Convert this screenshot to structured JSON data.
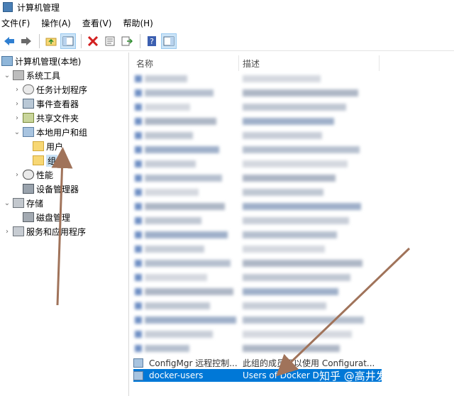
{
  "window": {
    "title": "计算机管理"
  },
  "menu": {
    "items": [
      "文件(F)",
      "操作(A)",
      "查看(V)",
      "帮助(H)"
    ]
  },
  "toolbar": {
    "back_icon": "arrow-left-icon",
    "forward_icon": "arrow-right-icon",
    "delete_icon": "red-x-icon",
    "help_icon": "help-icon"
  },
  "tree": {
    "root": "计算机管理(本地)",
    "items": [
      {
        "label": "系统工具",
        "icon": "tools-icon"
      },
      {
        "label": "任务计划程序",
        "icon": "clock-icon"
      },
      {
        "label": "事件查看器",
        "icon": "event-viewer-icon"
      },
      {
        "label": "共享文件夹",
        "icon": "shared-folder-icon"
      },
      {
        "label": "本地用户和组",
        "icon": "local-users-icon"
      },
      {
        "label": "用户",
        "icon": "folder-icon"
      },
      {
        "label": "组",
        "icon": "folder-icon"
      },
      {
        "label": "性能",
        "icon": "performance-icon"
      },
      {
        "label": "设备管理器",
        "icon": "device-manager-icon"
      },
      {
        "label": "存储",
        "icon": "storage-icon"
      },
      {
        "label": "磁盘管理",
        "icon": "disk-icon"
      },
      {
        "label": "服务和应用程序",
        "icon": "services-icon"
      }
    ]
  },
  "list": {
    "columns": [
      "名称",
      "描述"
    ],
    "partial_row": {
      "name": "ConfigMgr 远程控制...",
      "desc": "此组的成员可以使用 Configurat..."
    },
    "selected_row": {
      "name": "docker-users",
      "desc": "Users of Docker D"
    }
  },
  "watermark": "知乎 @高井发不可用",
  "colors": {
    "selection": "#0078d7",
    "annotation_arrow": "#a0735a"
  }
}
